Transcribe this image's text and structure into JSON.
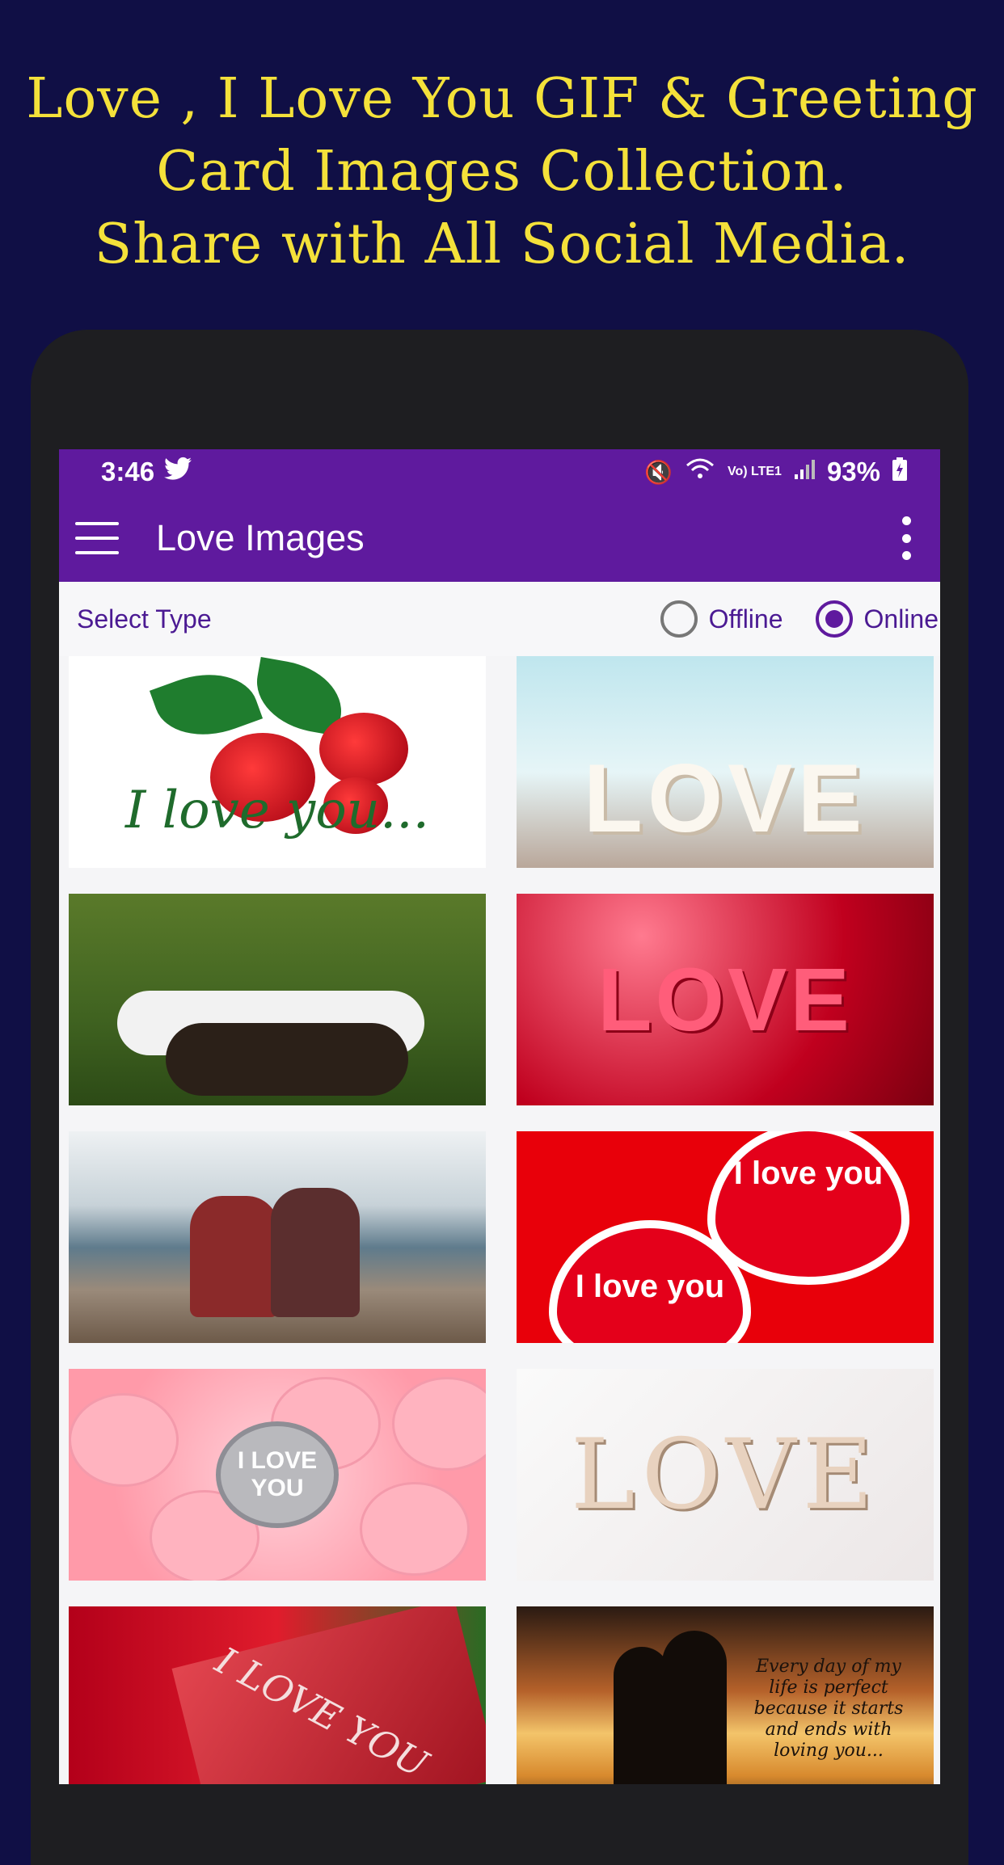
{
  "headline": {
    "line1": "Love , I Love You GIF & Greeting",
    "line2": "Card Images Collection.",
    "line3": "Share with All Social Media."
  },
  "status_bar": {
    "time": "3:46",
    "network_label": "Vo) LTE1",
    "battery": "93%"
  },
  "app_bar": {
    "title": "Love Images"
  },
  "select_bar": {
    "label": "Select Type",
    "options": [
      {
        "label": "Offline",
        "selected": false
      },
      {
        "label": "Online",
        "selected": true
      }
    ]
  },
  "tiles": [
    {
      "caption": "I love you..."
    },
    {
      "caption": "LOVE"
    },
    {
      "caption": ""
    },
    {
      "caption": "LOVE"
    },
    {
      "caption": ""
    },
    {
      "caption_a": "I love you",
      "caption_b": "I love you"
    },
    {
      "caption": "I LOVE YOU"
    },
    {
      "caption": "LOVE"
    },
    {
      "caption": "I LOVE YOU"
    },
    {
      "caption": "Every day of my life is perfect because it starts and ends with loving you..."
    }
  ],
  "colors": {
    "background": "#100f45",
    "headline": "#f4e13a",
    "app_bar": "#5f1a9e",
    "accent": "#5f1a9e"
  }
}
